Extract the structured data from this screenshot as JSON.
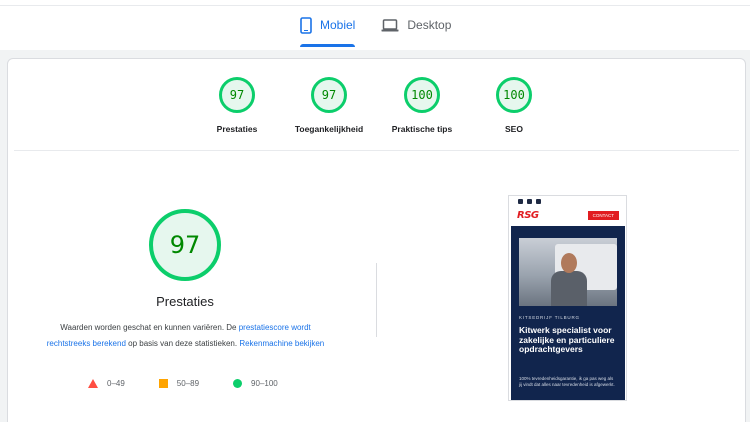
{
  "tabs": [
    {
      "label": "Mobiel",
      "icon": "smartphone-icon",
      "active": true
    },
    {
      "label": "Desktop",
      "icon": "laptop-icon",
      "active": false
    }
  ],
  "colors": {
    "accent": "#1a73e8",
    "pass": "#0cce6b",
    "pass_text": "#008800",
    "average": "#ffa400",
    "fail": "#ff4e42"
  },
  "categories": [
    {
      "score": "97",
      "label": "Prestaties"
    },
    {
      "score": "97",
      "label": "Toegankelijkheid"
    },
    {
      "score": "100",
      "label": "Praktische tips"
    },
    {
      "score": "100",
      "label": "SEO"
    }
  ],
  "performance": {
    "score": "97",
    "title": "Prestaties",
    "desc_part1": "Waarden worden geschat en kunnen variëren. De ",
    "desc_link1": "prestatiescore wordt rechtstreeks berekend",
    "desc_part2": " op basis van deze statistieken. ",
    "desc_link2": "Rekenmachine bekijken"
  },
  "legend": [
    {
      "icon": "triangle-icon",
      "range": "0–49"
    },
    {
      "icon": "square-icon",
      "range": "50–89"
    },
    {
      "icon": "circle-icon",
      "range": "90–100"
    }
  ],
  "screenshot": {
    "logo": "RSG",
    "contact_button": "CONTACT",
    "kicker": "KITSEDRIJF TILBURG",
    "headline": "Kitwerk specialist voor zakelijke en particuliere opdrachtgevers",
    "body": "100% tevredenheidsgarantie, ik ga pas weg als jij vindt dat alles naar tevredenheid is afgewerkt."
  }
}
